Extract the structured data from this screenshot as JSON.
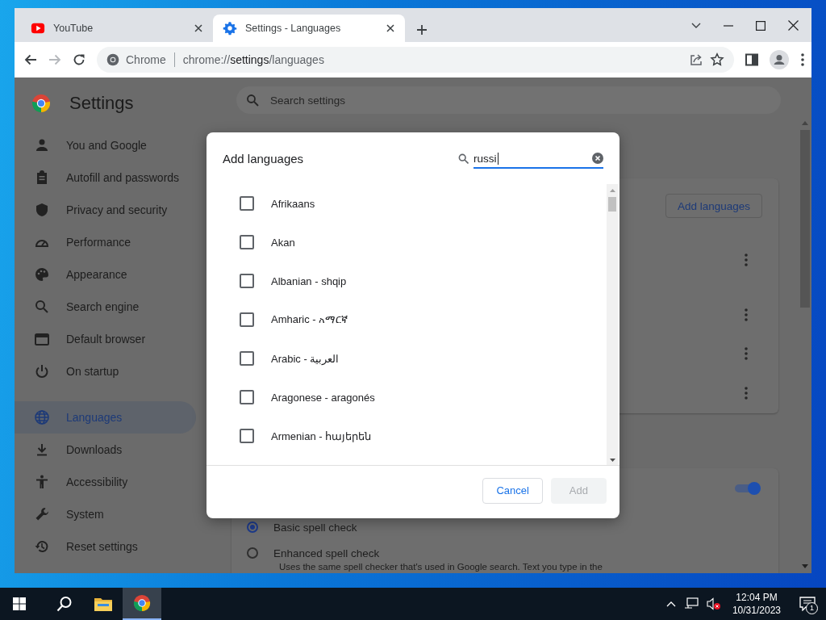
{
  "browser": {
    "tabs": [
      {
        "title": "YouTube",
        "selected": false
      },
      {
        "title": "Settings - Languages",
        "selected": true
      }
    ],
    "navigation": {
      "back_disabled": false,
      "forward_disabled": true
    },
    "address_bar": {
      "site_label": "Chrome",
      "url": "chrome://**settings**/languages"
    }
  },
  "settings": {
    "title": "Settings",
    "search_placeholder": "Search settings",
    "nav_groups": [
      {
        "items": [
          {
            "label": "You and Google",
            "selected": false
          },
          {
            "label": "Autofill and passwords",
            "selected": false
          },
          {
            "label": "Privacy and security",
            "selected": false
          },
          {
            "label": "Performance",
            "selected": false
          },
          {
            "label": "Appearance",
            "selected": false
          },
          {
            "label": "Search engine",
            "selected": false
          },
          {
            "label": "Default browser",
            "selected": false
          },
          {
            "label": "On startup",
            "selected": false
          }
        ]
      },
      {
        "items": [
          {
            "label": "Languages",
            "selected": true
          },
          {
            "label": "Downloads",
            "selected": false
          },
          {
            "label": "Accessibility",
            "selected": false
          },
          {
            "label": "System",
            "selected": false
          },
          {
            "label": "Reset settings",
            "selected": false
          }
        ]
      }
    ],
    "add_languages_button": "Add languages",
    "spell_check": {
      "on": true,
      "options": [
        {
          "label": "Basic spell check",
          "selected": true
        },
        {
          "label": "Enhanced spell check",
          "selected": false,
          "description": "Uses the same spell checker that's used in Google search. Text you type in the"
        }
      ]
    }
  },
  "dialog": {
    "title": "Add languages",
    "search_value": "russi",
    "languages": [
      {
        "label": "Afrikaans",
        "checked": false
      },
      {
        "label": "Akan",
        "checked": false
      },
      {
        "label": "Albanian - shqip",
        "checked": false
      },
      {
        "label": "Amharic - አማርኛ",
        "checked": false
      },
      {
        "label": "Arabic - العربية",
        "checked": false
      },
      {
        "label": "Aragonese - aragonés",
        "checked": false
      },
      {
        "label": "Armenian - հայերեն",
        "checked": false
      }
    ],
    "buttons": [
      {
        "label": "Cancel",
        "disabled": false
      },
      {
        "label": "Add",
        "disabled": true
      }
    ]
  },
  "taskbar": {
    "time": "12:04 PM",
    "date": "10/31/2023",
    "notification_count": "1"
  }
}
